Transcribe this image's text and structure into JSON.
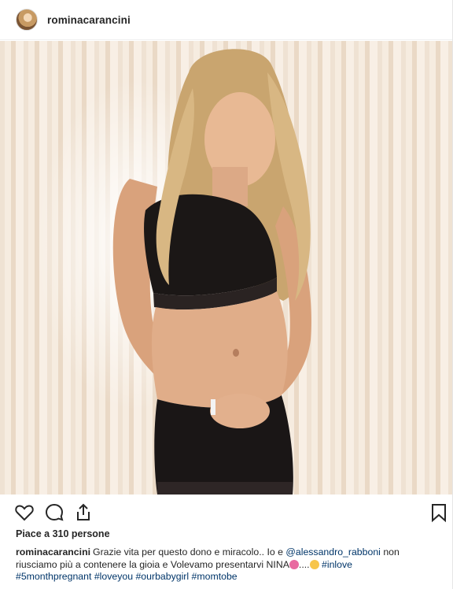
{
  "post": {
    "username": "rominacarancini",
    "likes_text": "Piace a 310 persone",
    "caption": {
      "username": "rominacarancini",
      "text_1": "Grazie vita per questo dono e miracolo.. Io e ",
      "mention": "@alessandro_rabboni",
      "text_2": " non riusciamo più a contenere la gioia e Volevamo presentarvi NINA",
      "text_3": "....",
      "hashtags_1": " #inlove",
      "hashtags_2": "#5monthpregnant #loveyou #ourbabygirl #momtobe",
      "emojis": [
        "flower-emoji",
        "smile-emoji"
      ]
    }
  },
  "icons": {
    "like": "heart-icon",
    "comment": "comment-icon",
    "share": "share-icon",
    "save": "bookmark-icon"
  },
  "colors": {
    "text": "#262626",
    "link": "#003569",
    "border": "#efefef"
  }
}
